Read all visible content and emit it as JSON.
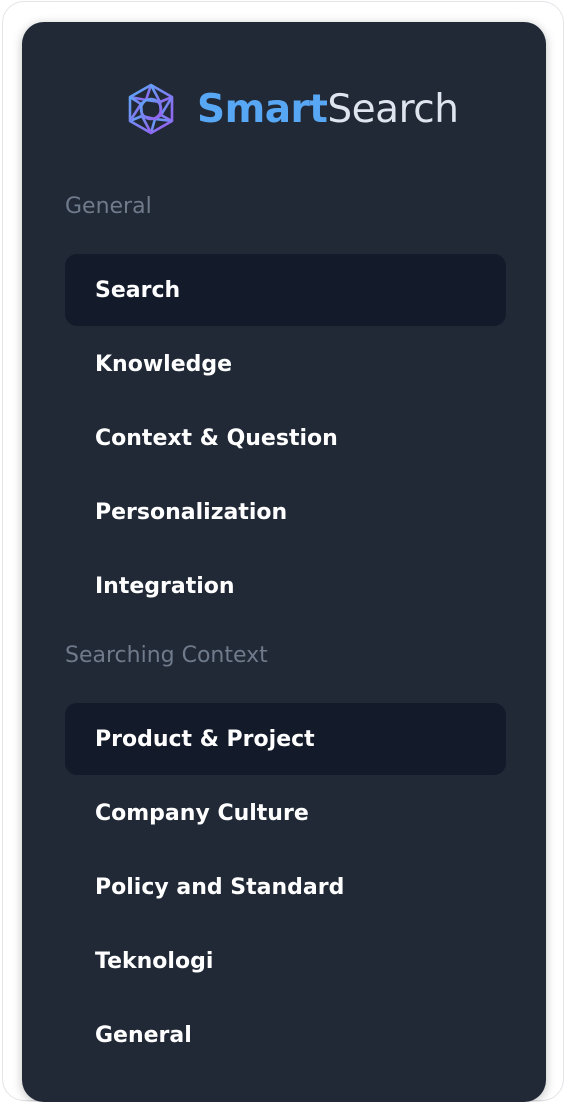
{
  "brand": {
    "name_part1": "Smart",
    "name_part2": "Search",
    "logo_icon": "network-sphere-icon",
    "colors": {
      "accent_blue": "#58a7f5",
      "accent_purple": "#8a6bf0",
      "text_light": "#dfe5ee"
    }
  },
  "sidebar": {
    "background": "#212937",
    "active_background": "#131a2a",
    "sections": [
      {
        "label": "General",
        "items": [
          {
            "label": "Search",
            "active": true
          },
          {
            "label": "Knowledge",
            "active": false
          },
          {
            "label": "Context & Question",
            "active": false
          },
          {
            "label": "Personalization",
            "active": false
          },
          {
            "label": "Integration",
            "active": false
          }
        ]
      },
      {
        "label": "Searching Context",
        "items": [
          {
            "label": "Product & Project",
            "active": true
          },
          {
            "label": "Company Culture",
            "active": false
          },
          {
            "label": "Policy and Standard",
            "active": false
          },
          {
            "label": "Teknologi",
            "active": false
          },
          {
            "label": "General",
            "active": false
          }
        ]
      }
    ]
  }
}
